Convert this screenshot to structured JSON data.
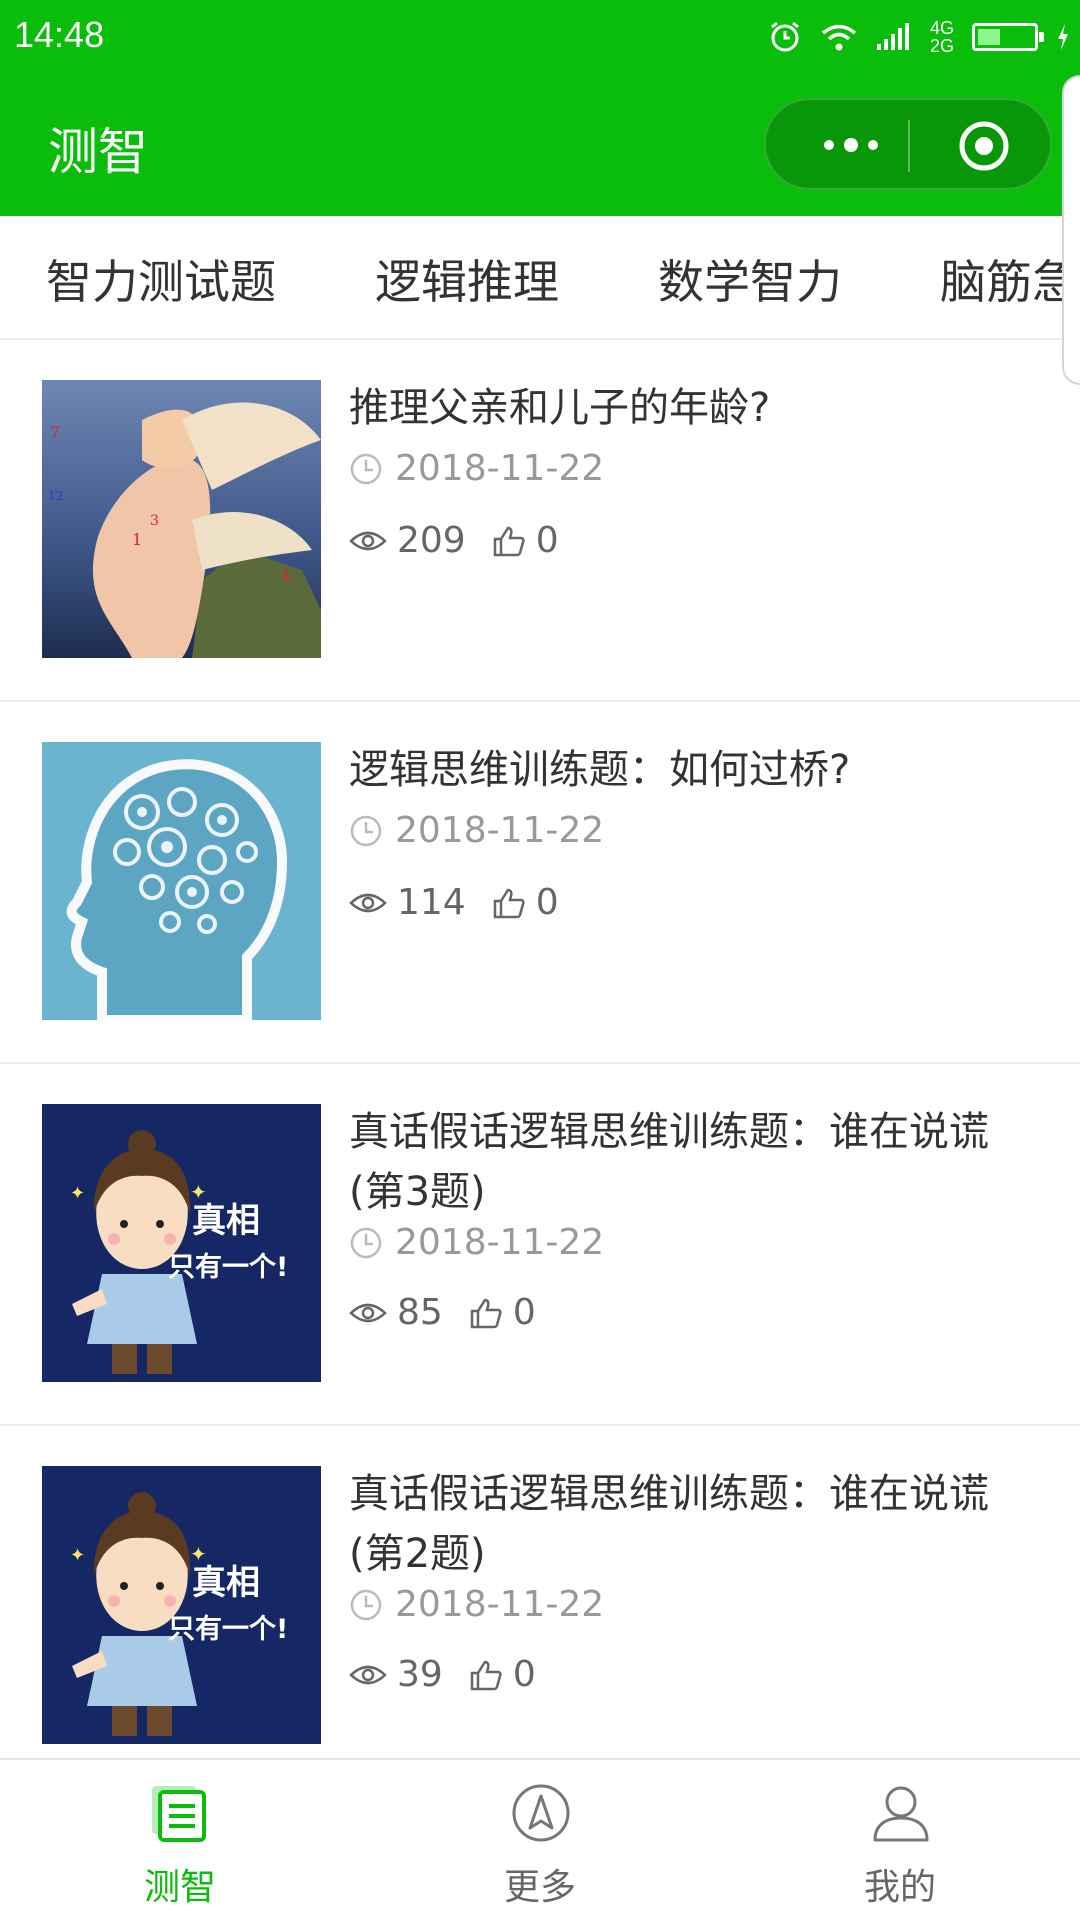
{
  "status_bar": {
    "time": "14:48",
    "network_top": "4G",
    "network_bottom": "2G",
    "battery_level": 0.4
  },
  "header": {
    "title": "测智",
    "accent_color": "#0bbd0b"
  },
  "tabs": [
    {
      "label": "智力测试题"
    },
    {
      "label": "逻辑推理"
    },
    {
      "label": "数学智力"
    },
    {
      "label": "脑筋急"
    }
  ],
  "articles": [
    {
      "title": "推理父亲和儿子的年龄?",
      "date": "2018-11-22",
      "views": "209",
      "likes": "0",
      "thumb": "winged-face"
    },
    {
      "title": "逻辑思维训练题：如何过桥?",
      "date": "2018-11-22",
      "views": "114",
      "likes": "0",
      "thumb": "gear-head"
    },
    {
      "title": "真话假话逻辑思维训练题：谁在说谎(第3题)",
      "date": "2018-11-22",
      "views": "85",
      "likes": "0",
      "thumb": "detective-cartoon",
      "thumb_text_1": "真相",
      "thumb_text_2": "只有一个!"
    },
    {
      "title": "真话假话逻辑思维训练题：谁在说谎(第2题)",
      "date": "2018-11-22",
      "views": "39",
      "likes": "0",
      "thumb": "detective-cartoon",
      "thumb_text_1": "真相",
      "thumb_text_2": "只有一个!"
    }
  ],
  "bottom_nav": [
    {
      "label": "测智",
      "icon": "list-icon",
      "active": true
    },
    {
      "label": "更多",
      "icon": "compass-icon",
      "active": false
    },
    {
      "label": "我的",
      "icon": "user-icon",
      "active": false
    }
  ]
}
